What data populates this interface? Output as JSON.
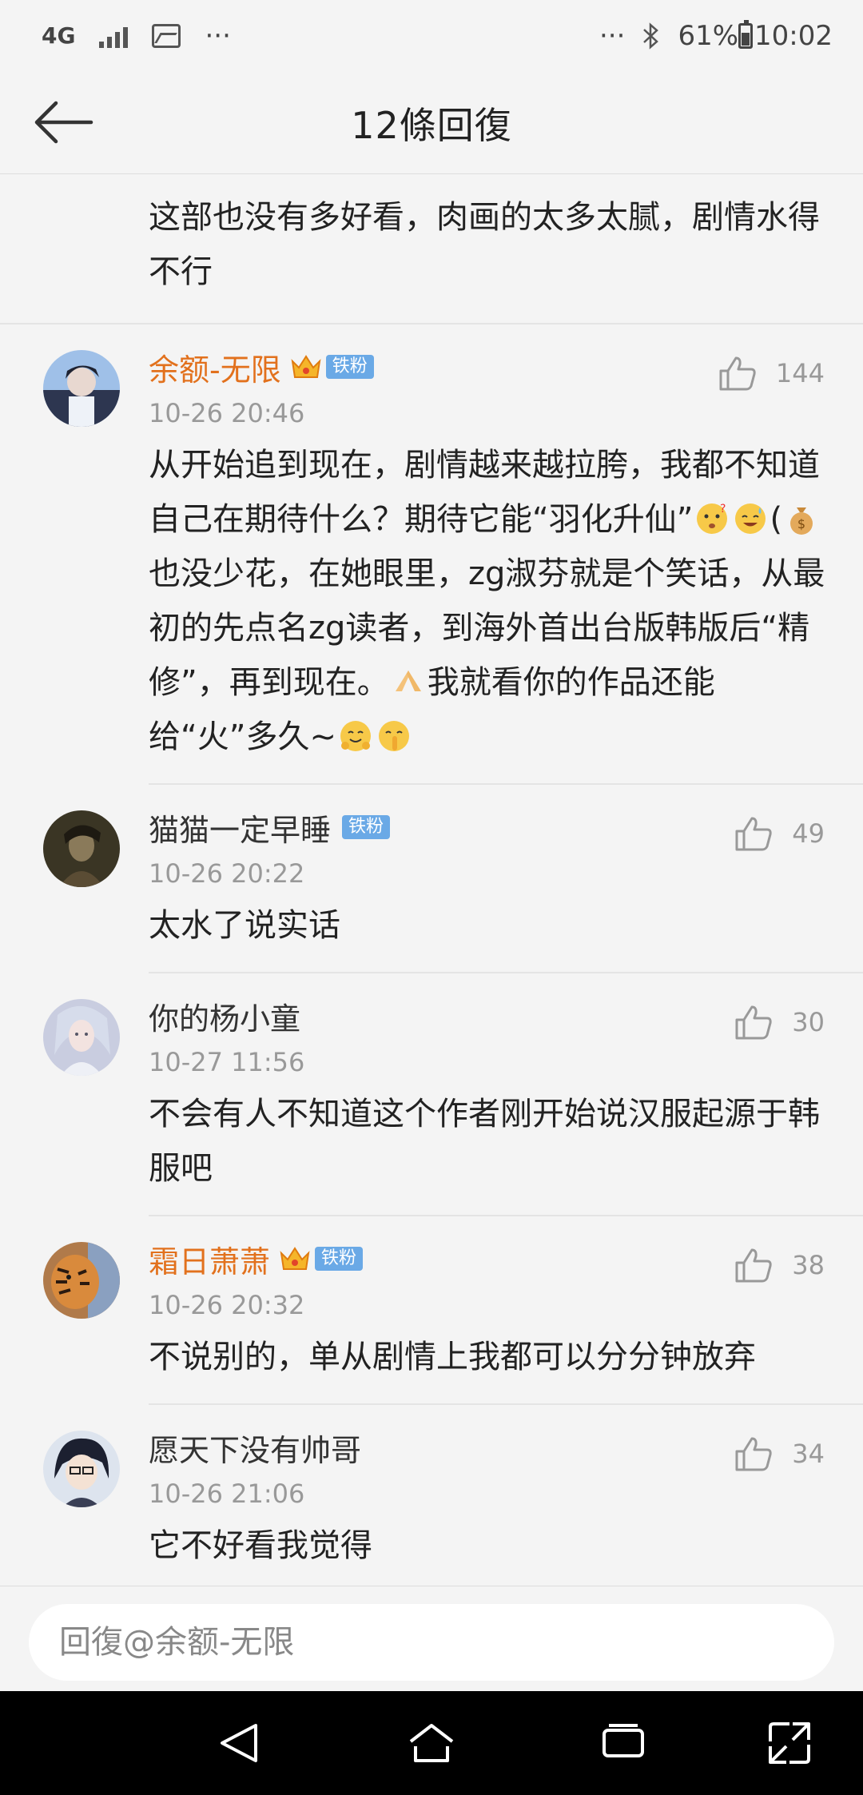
{
  "status_bar": {
    "network": "4G",
    "more_left": "···",
    "more_right": "···",
    "battery": "61%",
    "time": "10:02"
  },
  "header": {
    "title": "12條回復"
  },
  "top_text": "这部也没有多好看，肉画的太多太腻，剧情水得不行",
  "comments": [
    {
      "name": "余额-无限",
      "vip": true,
      "badge": "铁粉",
      "time": "10-26 20:46",
      "likes": "144",
      "text_parts": [
        "从开始追到现在，剧情越来越拉胯，我都不知道自己在期待什么？期待它能“羽化升仙”",
        "(",
        "也没少花，在她眼里，zg淑芬就是个笑话，从最初的先点名zg读者，到海外首出台版韩版后“精修”，再到现在。",
        "我就看你的作品还能给“火”多久~"
      ]
    },
    {
      "name": "猫猫一定早睡",
      "vip": false,
      "badge": "铁粉",
      "time": "10-26 20:22",
      "likes": "49",
      "text": "太水了说实话"
    },
    {
      "name": "你的杨小童",
      "vip": false,
      "time": "10-27 11:56",
      "likes": "30",
      "text": "不会有人不知道这个作者刚开始说汉服起源于韩服吧"
    },
    {
      "name": "霜日萧萧",
      "vip": true,
      "badge": "铁粉",
      "time": "10-26 20:32",
      "likes": "38",
      "text": "不说别的，单从剧情上我都可以分分钟放弃"
    },
    {
      "name": "愿天下没有帅哥",
      "vip": false,
      "time": "10-26 21:06",
      "likes": "34",
      "text": "它不好看我觉得"
    }
  ],
  "reply": {
    "placeholder": "回復@余额-无限"
  },
  "colors": {
    "vip_name": "#e2711d",
    "badge": "#6aa9e6",
    "background": "#f4f4f4"
  },
  "icons": [
    "back-arrow-icon",
    "thumb-up-icon",
    "crown-icon",
    "nav-back-icon",
    "nav-home-icon",
    "nav-recent-icon",
    "nav-expand-icon"
  ]
}
